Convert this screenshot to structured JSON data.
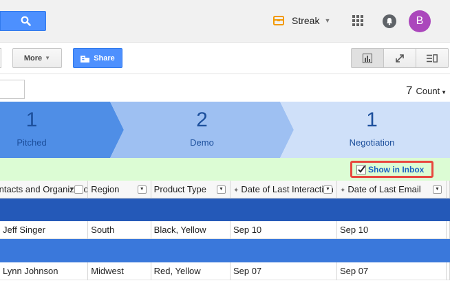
{
  "topbar": {
    "streak_label": "Streak",
    "avatar_letter": "B",
    "icons": [
      "search-icon",
      "streak-logo-icon",
      "apps-grid-icon",
      "notifications-bell-icon"
    ]
  },
  "toolbar": {
    "more_label": "More",
    "share_label": "Share",
    "view_icons": [
      "chart-view-icon",
      "expand-icon",
      "list-view-icon"
    ]
  },
  "filter": {
    "count_value": "7",
    "count_label": "Count"
  },
  "pipeline": {
    "stages": [
      {
        "count": "1",
        "label": "Pitched"
      },
      {
        "count": "2",
        "label": "Demo"
      },
      {
        "count": "1",
        "label": "Negotiation"
      }
    ],
    "colors": [
      "#4f8ee6",
      "#9ec0f2",
      "#cfe0f9"
    ]
  },
  "inbox": {
    "show_in_inbox_label": "Show in Inbox",
    "checked": true
  },
  "table": {
    "columns": [
      "Contacts and Organizations",
      "Region",
      "Product Type",
      "Date of Last Interaction",
      "Date of Last Email"
    ],
    "rows": [
      [
        "Jeff Singer",
        "South",
        "Black, Yellow",
        "Sep 10",
        "Sep 10"
      ],
      [
        "Lynn Johnson",
        "Midwest",
        "Red, Yellow",
        "Sep 07",
        "Sep 07"
      ]
    ],
    "group_colors": [
      "#2459b8",
      "#3a78db"
    ]
  }
}
